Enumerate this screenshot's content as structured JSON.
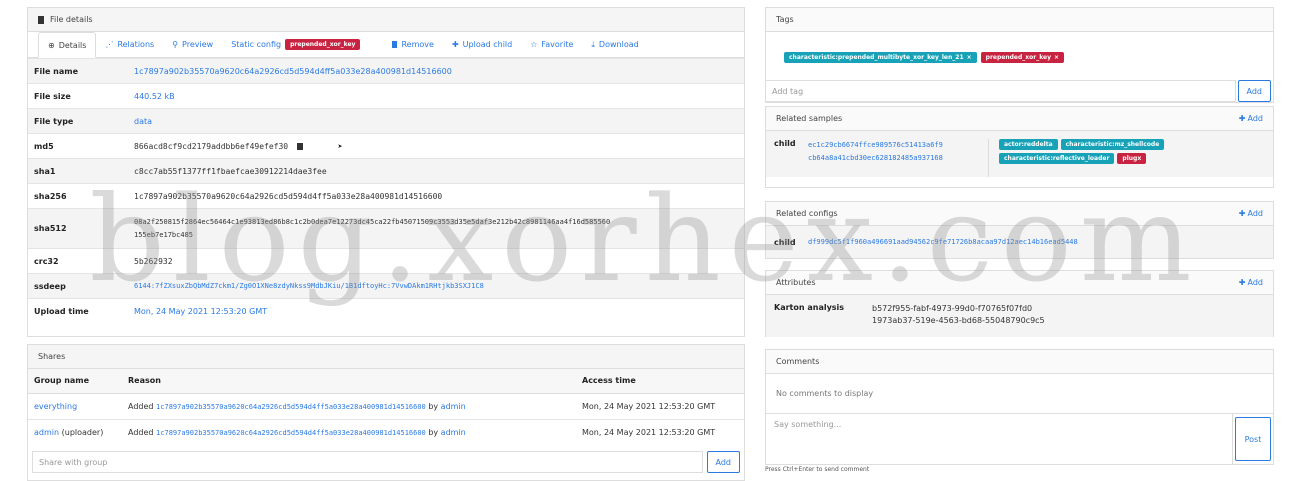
{
  "file_details": {
    "header": "File details",
    "tabs": [
      {
        "label": "Details",
        "icon": "fingerprint-icon"
      },
      {
        "label": "Relations",
        "icon": "relations-icon"
      },
      {
        "label": "Preview",
        "icon": "search-icon"
      },
      {
        "label": "Static config",
        "icon": ""
      },
      {
        "label": "Remove",
        "icon": "trash-icon"
      },
      {
        "label": "Upload child",
        "icon": "plus-icon"
      },
      {
        "label": "Favorite",
        "icon": "star-icon"
      },
      {
        "label": "Download",
        "icon": "download-icon"
      }
    ],
    "static_config_badge": "prepended_xor_key",
    "rows": [
      {
        "key": "File name",
        "value": "1c7897a902b35570a9620c64a2926cd5d594d4ff5a033e28a400981d14516600"
      },
      {
        "key": "File size",
        "value": "440.52 kB"
      },
      {
        "key": "File type",
        "value": "data"
      },
      {
        "key": "md5",
        "value": "866acd8cf9cd2179addbb6ef49efef30"
      },
      {
        "key": "sha1",
        "value": "c8cc7ab55f1377ff1fbaefcae30912214dae3fee"
      },
      {
        "key": "sha256",
        "value": "1c7897a902b35570a9620c64a2926cd5d594d4ff5a033e28a400981d14516600"
      },
      {
        "key": "sha512",
        "value": "08a2f250815f2864ec56464c1e93813ed86b8c1c2b0dea7e12273dc45ca22fb45071509c3553d35e5daf3e212b42c8981146aa4f16d585560",
        "value2": "155eb7e17bc485"
      },
      {
        "key": "crc32",
        "value": "5b262932"
      },
      {
        "key": "ssdeep",
        "value": "6144:7fZXsuxZbQbMdZ7ckm1/Zg0O1XNe8zdyNkss9MdbJKiu/1B1dftoyHc:7VvwDAkm1RHtjkb3SXJ1C8"
      },
      {
        "key": "Upload time",
        "value": "Mon, 24 May 2021 12:53:20 GMT"
      }
    ]
  },
  "shares": {
    "header": "Shares",
    "columns": [
      "Group name",
      "Reason",
      "Access time"
    ],
    "rows": [
      {
        "group": "everything",
        "group_suffix": "",
        "reason_prefix": "Added",
        "hash": "1c7897a902b35570a9620c64a2926cd5d594d4ff5a033e28a400981d14516600",
        "by": "by",
        "user": "admin",
        "time": "Mon, 24 May 2021 12:53:20 GMT"
      },
      {
        "group": "admin",
        "group_suffix": "(uploader)",
        "reason_prefix": "Added",
        "hash": "1c7897a902b35570a9620c64a2926cd5d594d4ff5a033e28a400981d14516600",
        "by": "by",
        "user": "admin",
        "time": "Mon, 24 May 2021 12:53:20 GMT"
      }
    ],
    "share_placeholder": "Share with group",
    "add_label": "Add"
  },
  "tags": {
    "header": "Tags",
    "items": [
      {
        "label": "characteristic:prepended_multibyte_xor_key_len_21",
        "color": "#17a2b8"
      },
      {
        "label": "prepended_xor_key",
        "color": "#c82340"
      }
    ],
    "remove_glyph": "×",
    "add_placeholder": "Add tag",
    "add_label": "Add"
  },
  "related_samples": {
    "header": "Related samples",
    "add_label": "Add",
    "relation": "child",
    "hashes": [
      "ec1c29cb6674ffce989576c51413a6f9",
      "cb64a8a41cbd30ec628182485a937168"
    ],
    "tags": [
      {
        "label": "actor:reddelta",
        "color": "#17a2b8"
      },
      {
        "label": "characteristic:mz_shellcode",
        "color": "#17a2b8"
      },
      {
        "label": "characteristic:reflective_loader",
        "color": "#17a2b8"
      },
      {
        "label": "plugx",
        "color": "#c82340"
      }
    ]
  },
  "related_configs": {
    "header": "Related configs",
    "add_label": "Add",
    "relation": "child",
    "hash": "df999dc5f1f960a496691aad94562c9fe71726b8acaa97d12aec14b16ead5448"
  },
  "attributes": {
    "header": "Attributes",
    "add_label": "Add",
    "key": "Karton analysis",
    "values": [
      "b572f955-fabf-4973-99d0-f70765f07fd0",
      "1973ab37-519e-4563-bd68-55048790c9c5"
    ]
  },
  "comments": {
    "header": "Comments",
    "empty": "No comments to display",
    "placeholder": "Say something...",
    "post_label": "Post",
    "hint": "Press Ctrl+Enter to send comment"
  },
  "watermark": "blog.xorhex.com",
  "colors": {
    "accent": "#2a7ae2",
    "danger": "#c82340",
    "info": "#17a2b8"
  }
}
